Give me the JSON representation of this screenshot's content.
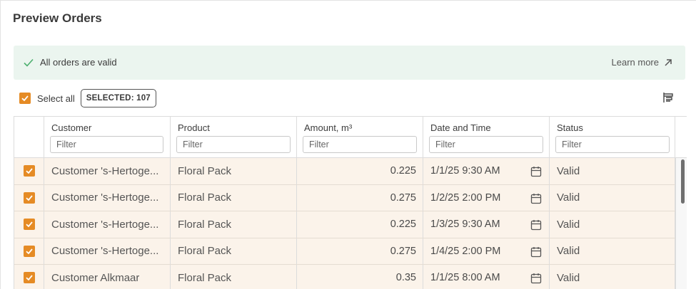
{
  "page": {
    "title": "Preview Orders"
  },
  "banner": {
    "message": "All orders are valid",
    "link_label": "Learn more"
  },
  "selection": {
    "select_all_label": "Select all",
    "badge": "SELECTED: 107"
  },
  "table": {
    "columns": [
      {
        "label": "Customer",
        "placeholder": "Filter"
      },
      {
        "label": "Product",
        "placeholder": "Filter"
      },
      {
        "label": "Amount, m³",
        "placeholder": "Filter"
      },
      {
        "label": "Date and Time",
        "placeholder": "Filter"
      },
      {
        "label": "Status",
        "placeholder": "Filter"
      }
    ],
    "rows": [
      {
        "customer": "Customer 's-Hertoge...",
        "product": "Floral Pack",
        "amount": "0.225",
        "datetime": "1/1/25 9:30 AM",
        "status": "Valid"
      },
      {
        "customer": "Customer 's-Hertoge...",
        "product": "Floral Pack",
        "amount": "0.275",
        "datetime": "1/2/25 2:00 PM",
        "status": "Valid"
      },
      {
        "customer": "Customer 's-Hertoge...",
        "product": "Floral Pack",
        "amount": "0.225",
        "datetime": "1/3/25 9:30 AM",
        "status": "Valid"
      },
      {
        "customer": "Customer 's-Hertoge...",
        "product": "Floral Pack",
        "amount": "0.275",
        "datetime": "1/4/25 2:00 PM",
        "status": "Valid"
      },
      {
        "customer": "Customer Alkmaar",
        "product": "Floral Pack",
        "amount": "0.35",
        "datetime": "1/1/25 8:00 AM",
        "status": "Valid"
      }
    ]
  },
  "colors": {
    "accent": "#e58b25",
    "success": "#4caf6e",
    "banner_bg": "#ebf5ef",
    "row_bg": "#fbf3ea"
  }
}
